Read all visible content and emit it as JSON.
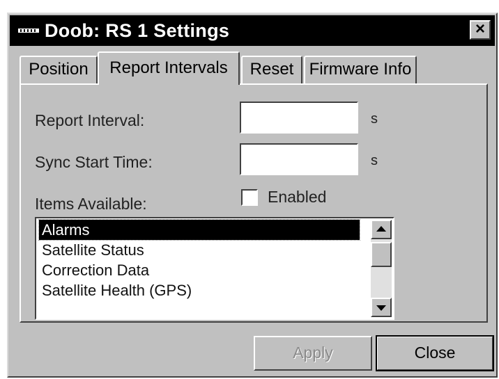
{
  "window": {
    "title": "Doob: RS 1 Settings",
    "close_glyph": "×"
  },
  "tabs": [
    {
      "label": "Position",
      "active": false
    },
    {
      "label": "Report Intervals",
      "active": true
    },
    {
      "label": "Reset",
      "active": false
    },
    {
      "label": "Firmware Info",
      "active": false
    }
  ],
  "form": {
    "report_interval_label": "Report Interval:",
    "report_interval_value": "",
    "report_interval_unit": "s",
    "sync_start_label": "Sync Start Time:",
    "sync_start_value": "",
    "sync_start_unit": "s",
    "items_available_label": "Items Available:",
    "enabled_label": "Enabled",
    "enabled_checked": false
  },
  "list": {
    "items": [
      "Alarms",
      "Satellite Status",
      "Correction Data",
      "Satellite Health (GPS)"
    ],
    "selected_index": 0
  },
  "buttons": {
    "apply_label": "Apply",
    "close_label": "Close"
  },
  "icons": {
    "window_icon": "app-icon",
    "scroll_up": "scroll-up-arrow-icon",
    "scroll_down": "scroll-down-arrow-icon"
  }
}
